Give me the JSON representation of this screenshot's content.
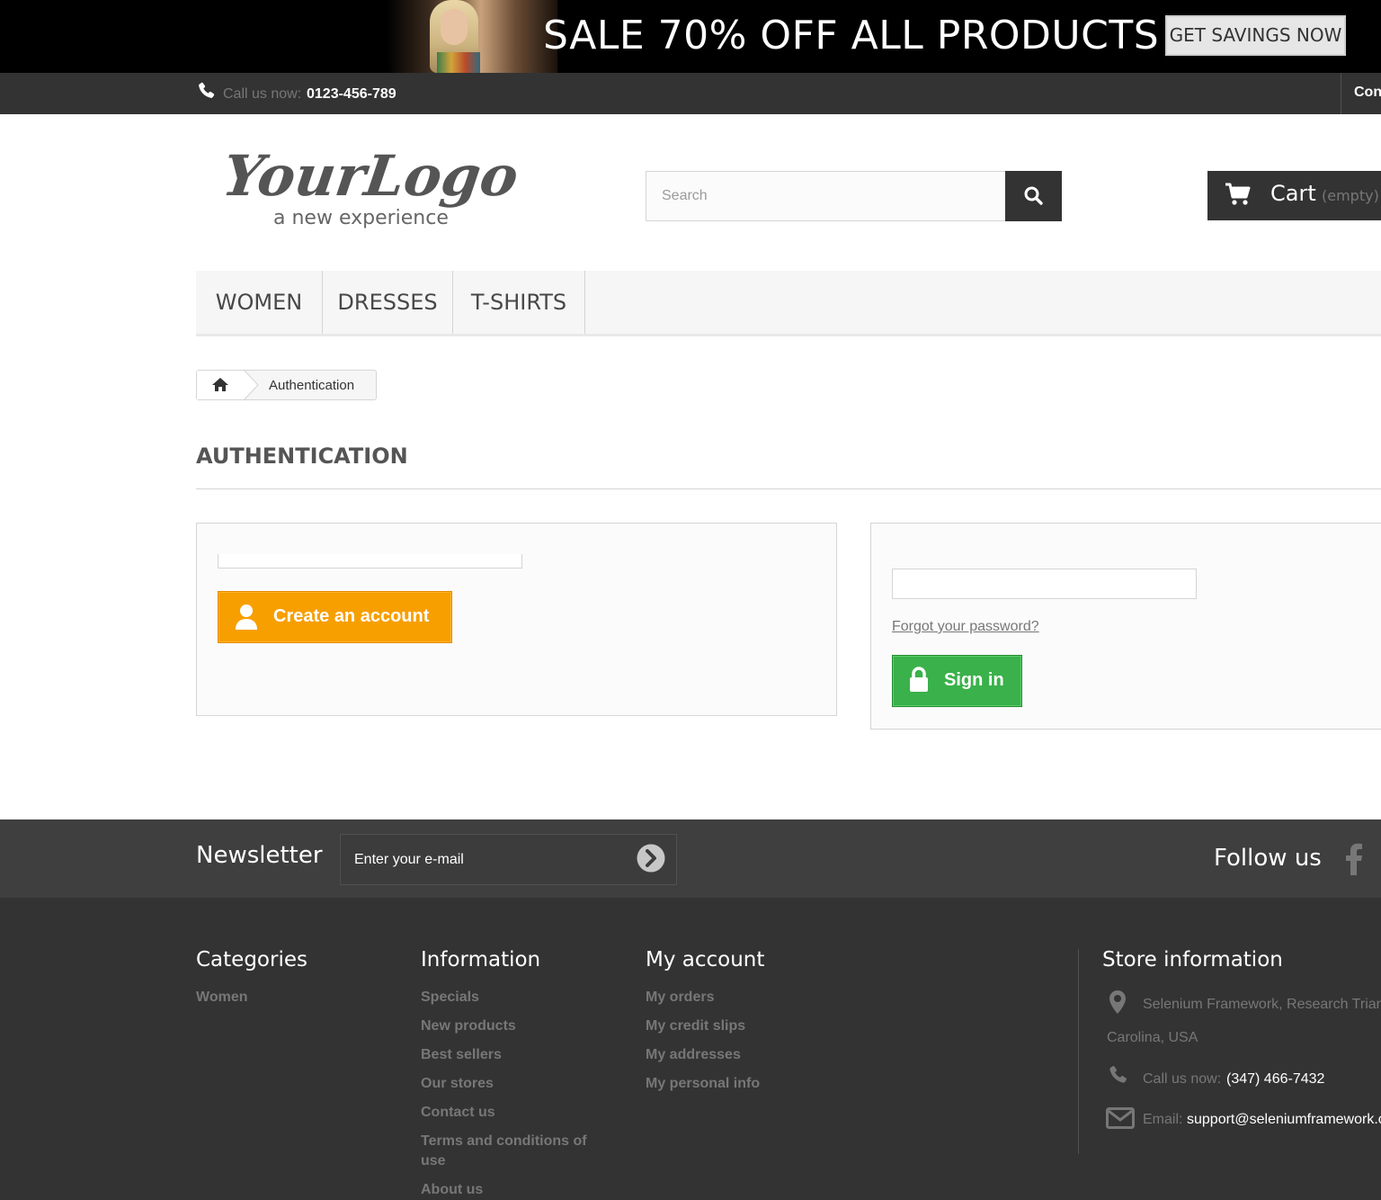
{
  "banner": {
    "text": "SALE 70% OFF ALL PRODUCTS",
    "button": "GET SAVINGS NOW"
  },
  "nav": {
    "call_label": "Call us now:",
    "call_number": "0123-456-789",
    "contact_link": "Contact us"
  },
  "header": {
    "logo_text": "YourLogo",
    "logo_tagline": "a new experience",
    "search_placeholder": "Search",
    "cart_label": "Cart",
    "cart_status": "(empty)"
  },
  "menu": {
    "items": [
      {
        "label": "WOMEN"
      },
      {
        "label": "DRESSES"
      },
      {
        "label": "T-SHIRTS"
      }
    ]
  },
  "breadcrumb": {
    "current": "Authentication"
  },
  "page": {
    "title": "AUTHENTICATION"
  },
  "create_account": {
    "button": "Create an account"
  },
  "login": {
    "forgot": "Forgot your password?",
    "button": "Sign in"
  },
  "newsletter": {
    "title": "Newsletter",
    "placeholder": "Enter your e-mail",
    "follow": "Follow us"
  },
  "footer": {
    "categories": {
      "title": "Categories",
      "links": [
        "Women"
      ]
    },
    "information": {
      "title": "Information",
      "links": [
        "Specials",
        "New products",
        "Best sellers",
        "Our stores",
        "Contact us",
        "Terms and conditions of use",
        "About us"
      ]
    },
    "my_account": {
      "title": "My account",
      "links": [
        "My orders",
        "My credit slips",
        "My addresses",
        "My personal info"
      ]
    },
    "store": {
      "title": "Store information",
      "address_line1": "Selenium Framework, Research Triangle, North",
      "address_line2": "Carolina, USA",
      "call_label": "Call us now:",
      "call_number": "(347) 466-7432",
      "email_label": "Email:",
      "email": "support@seleniumframework.com"
    }
  },
  "colors": {
    "dark": "#333333",
    "orange": "#f79f00",
    "green": "#3ab14a",
    "muted": "#777777"
  }
}
